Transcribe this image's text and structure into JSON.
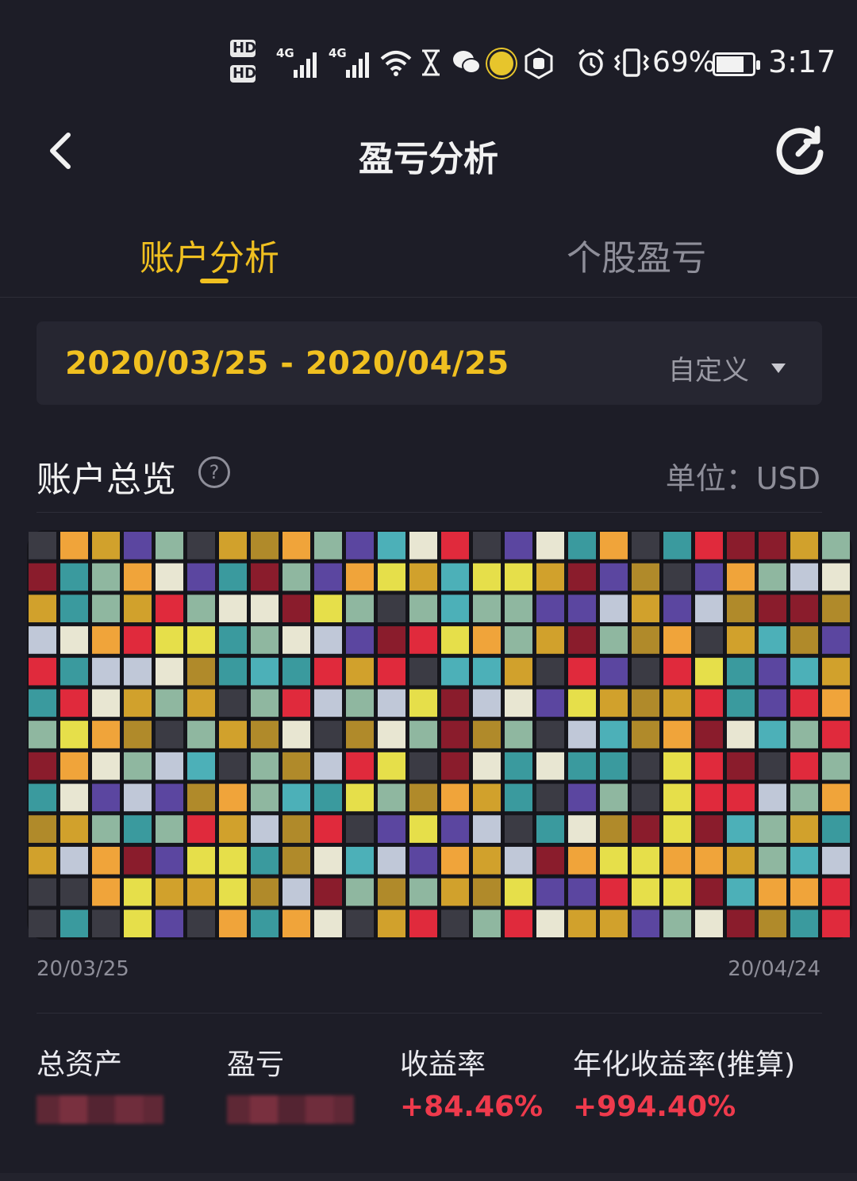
{
  "status_bar": {
    "hd1": "HD",
    "hd2": "HD",
    "net1": "4G",
    "net2": "4G",
    "battery": "69%",
    "time": "3:17"
  },
  "nav": {
    "title": "盈亏分析"
  },
  "tabs": [
    {
      "label": "账户分析",
      "active": true
    },
    {
      "label": "个股盈亏",
      "active": false
    }
  ],
  "date_range": {
    "value": "2020/03/25 - 2020/04/25",
    "mode": "自定义"
  },
  "overview": {
    "title": "账户总览",
    "help": "?",
    "unit": "单位：USD"
  },
  "chart": {
    "x_start": "20/03/25",
    "x_end": "20/04/24"
  },
  "stats": [
    {
      "label": "总资产"
    },
    {
      "label": "盈亏"
    },
    {
      "label": "收益率",
      "value": "+84.46%"
    },
    {
      "label": "年化收益率(推算)",
      "value": "+994.40%"
    }
  ],
  "colors": {
    "background": "#1d1d27",
    "accent": "#f0c020",
    "positive": "#ef3a4c",
    "muted": "#8e8e99"
  }
}
